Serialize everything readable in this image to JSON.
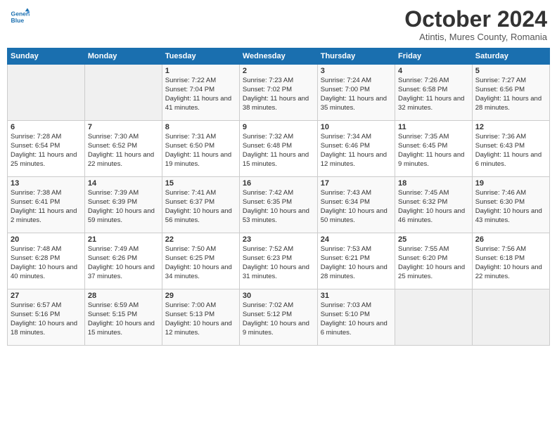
{
  "header": {
    "logo_line1": "General",
    "logo_line2": "Blue",
    "month": "October 2024",
    "location": "Atintis, Mures County, Romania"
  },
  "days_of_week": [
    "Sunday",
    "Monday",
    "Tuesday",
    "Wednesday",
    "Thursday",
    "Friday",
    "Saturday"
  ],
  "weeks": [
    [
      {
        "day": "",
        "text": ""
      },
      {
        "day": "",
        "text": ""
      },
      {
        "day": "1",
        "text": "Sunrise: 7:22 AM\nSunset: 7:04 PM\nDaylight: 11 hours and 41 minutes."
      },
      {
        "day": "2",
        "text": "Sunrise: 7:23 AM\nSunset: 7:02 PM\nDaylight: 11 hours and 38 minutes."
      },
      {
        "day": "3",
        "text": "Sunrise: 7:24 AM\nSunset: 7:00 PM\nDaylight: 11 hours and 35 minutes."
      },
      {
        "day": "4",
        "text": "Sunrise: 7:26 AM\nSunset: 6:58 PM\nDaylight: 11 hours and 32 minutes."
      },
      {
        "day": "5",
        "text": "Sunrise: 7:27 AM\nSunset: 6:56 PM\nDaylight: 11 hours and 28 minutes."
      }
    ],
    [
      {
        "day": "6",
        "text": "Sunrise: 7:28 AM\nSunset: 6:54 PM\nDaylight: 11 hours and 25 minutes."
      },
      {
        "day": "7",
        "text": "Sunrise: 7:30 AM\nSunset: 6:52 PM\nDaylight: 11 hours and 22 minutes."
      },
      {
        "day": "8",
        "text": "Sunrise: 7:31 AM\nSunset: 6:50 PM\nDaylight: 11 hours and 19 minutes."
      },
      {
        "day": "9",
        "text": "Sunrise: 7:32 AM\nSunset: 6:48 PM\nDaylight: 11 hours and 15 minutes."
      },
      {
        "day": "10",
        "text": "Sunrise: 7:34 AM\nSunset: 6:46 PM\nDaylight: 11 hours and 12 minutes."
      },
      {
        "day": "11",
        "text": "Sunrise: 7:35 AM\nSunset: 6:45 PM\nDaylight: 11 hours and 9 minutes."
      },
      {
        "day": "12",
        "text": "Sunrise: 7:36 AM\nSunset: 6:43 PM\nDaylight: 11 hours and 6 minutes."
      }
    ],
    [
      {
        "day": "13",
        "text": "Sunrise: 7:38 AM\nSunset: 6:41 PM\nDaylight: 11 hours and 2 minutes."
      },
      {
        "day": "14",
        "text": "Sunrise: 7:39 AM\nSunset: 6:39 PM\nDaylight: 10 hours and 59 minutes."
      },
      {
        "day": "15",
        "text": "Sunrise: 7:41 AM\nSunset: 6:37 PM\nDaylight: 10 hours and 56 minutes."
      },
      {
        "day": "16",
        "text": "Sunrise: 7:42 AM\nSunset: 6:35 PM\nDaylight: 10 hours and 53 minutes."
      },
      {
        "day": "17",
        "text": "Sunrise: 7:43 AM\nSunset: 6:34 PM\nDaylight: 10 hours and 50 minutes."
      },
      {
        "day": "18",
        "text": "Sunrise: 7:45 AM\nSunset: 6:32 PM\nDaylight: 10 hours and 46 minutes."
      },
      {
        "day": "19",
        "text": "Sunrise: 7:46 AM\nSunset: 6:30 PM\nDaylight: 10 hours and 43 minutes."
      }
    ],
    [
      {
        "day": "20",
        "text": "Sunrise: 7:48 AM\nSunset: 6:28 PM\nDaylight: 10 hours and 40 minutes."
      },
      {
        "day": "21",
        "text": "Sunrise: 7:49 AM\nSunset: 6:26 PM\nDaylight: 10 hours and 37 minutes."
      },
      {
        "day": "22",
        "text": "Sunrise: 7:50 AM\nSunset: 6:25 PM\nDaylight: 10 hours and 34 minutes."
      },
      {
        "day": "23",
        "text": "Sunrise: 7:52 AM\nSunset: 6:23 PM\nDaylight: 10 hours and 31 minutes."
      },
      {
        "day": "24",
        "text": "Sunrise: 7:53 AM\nSunset: 6:21 PM\nDaylight: 10 hours and 28 minutes."
      },
      {
        "day": "25",
        "text": "Sunrise: 7:55 AM\nSunset: 6:20 PM\nDaylight: 10 hours and 25 minutes."
      },
      {
        "day": "26",
        "text": "Sunrise: 7:56 AM\nSunset: 6:18 PM\nDaylight: 10 hours and 22 minutes."
      }
    ],
    [
      {
        "day": "27",
        "text": "Sunrise: 6:57 AM\nSunset: 5:16 PM\nDaylight: 10 hours and 18 minutes."
      },
      {
        "day": "28",
        "text": "Sunrise: 6:59 AM\nSunset: 5:15 PM\nDaylight: 10 hours and 15 minutes."
      },
      {
        "day": "29",
        "text": "Sunrise: 7:00 AM\nSunset: 5:13 PM\nDaylight: 10 hours and 12 minutes."
      },
      {
        "day": "30",
        "text": "Sunrise: 7:02 AM\nSunset: 5:12 PM\nDaylight: 10 hours and 9 minutes."
      },
      {
        "day": "31",
        "text": "Sunrise: 7:03 AM\nSunset: 5:10 PM\nDaylight: 10 hours and 6 minutes."
      },
      {
        "day": "",
        "text": ""
      },
      {
        "day": "",
        "text": ""
      }
    ]
  ]
}
